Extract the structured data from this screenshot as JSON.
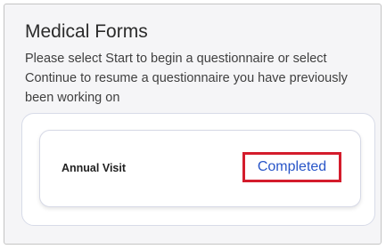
{
  "page": {
    "title": "Medical Forms",
    "instructions": "Please select Start to begin a questionnaire or select Continue to resume a questionnaire you have previously been working on"
  },
  "forms": [
    {
      "name": "Annual Visit",
      "status": "Completed"
    }
  ],
  "colors": {
    "status_link": "#2855c8",
    "highlight_border": "#d41c2c",
    "panel_background": "#f5f5f7"
  }
}
